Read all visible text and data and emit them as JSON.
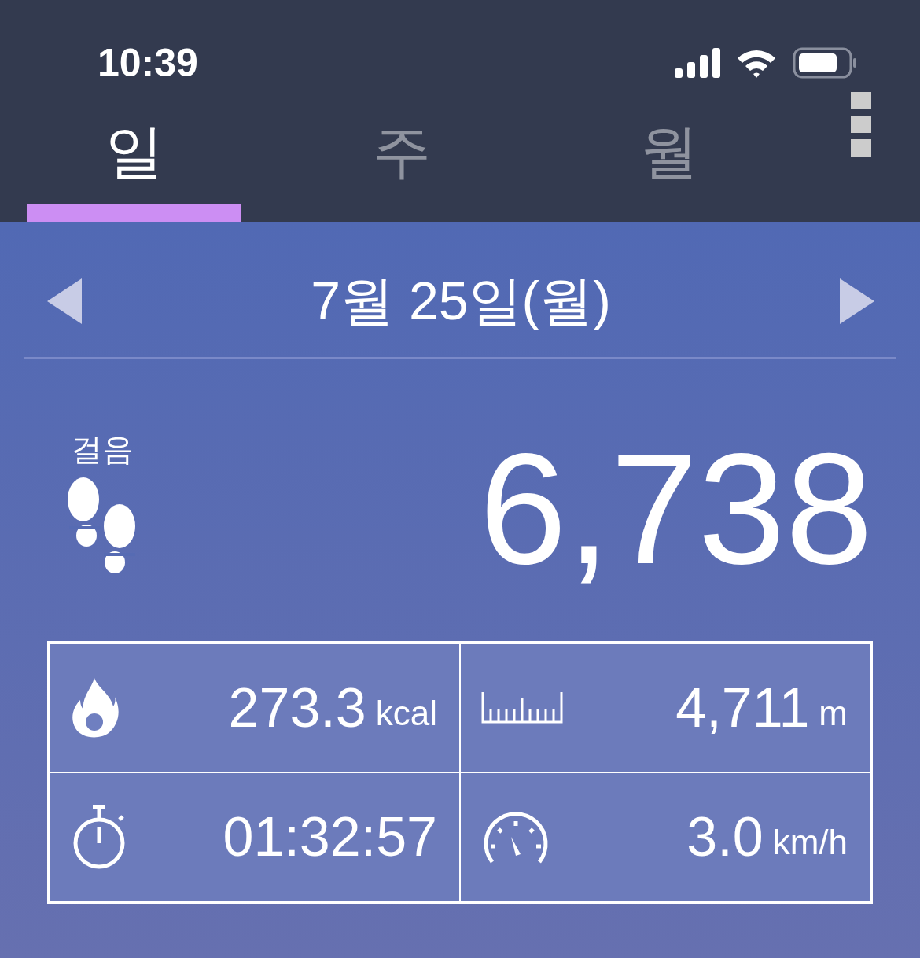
{
  "status_bar": {
    "time": "10:39"
  },
  "tabs": [
    {
      "label": "일",
      "selected": true
    },
    {
      "label": "주",
      "selected": false
    },
    {
      "label": "월",
      "selected": false
    }
  ],
  "date_nav": {
    "date": "7월 25일(월)"
  },
  "steps": {
    "label": "걸음",
    "value": "6,738"
  },
  "stats": [
    {
      "kind": "calories",
      "value": "273.3",
      "unit": "kcal"
    },
    {
      "kind": "distance",
      "value": "4,711",
      "unit": "m"
    },
    {
      "kind": "duration",
      "value": "01:32:57"
    },
    {
      "kind": "speed",
      "value": "3.0",
      "unit": "km/h"
    }
  ]
}
